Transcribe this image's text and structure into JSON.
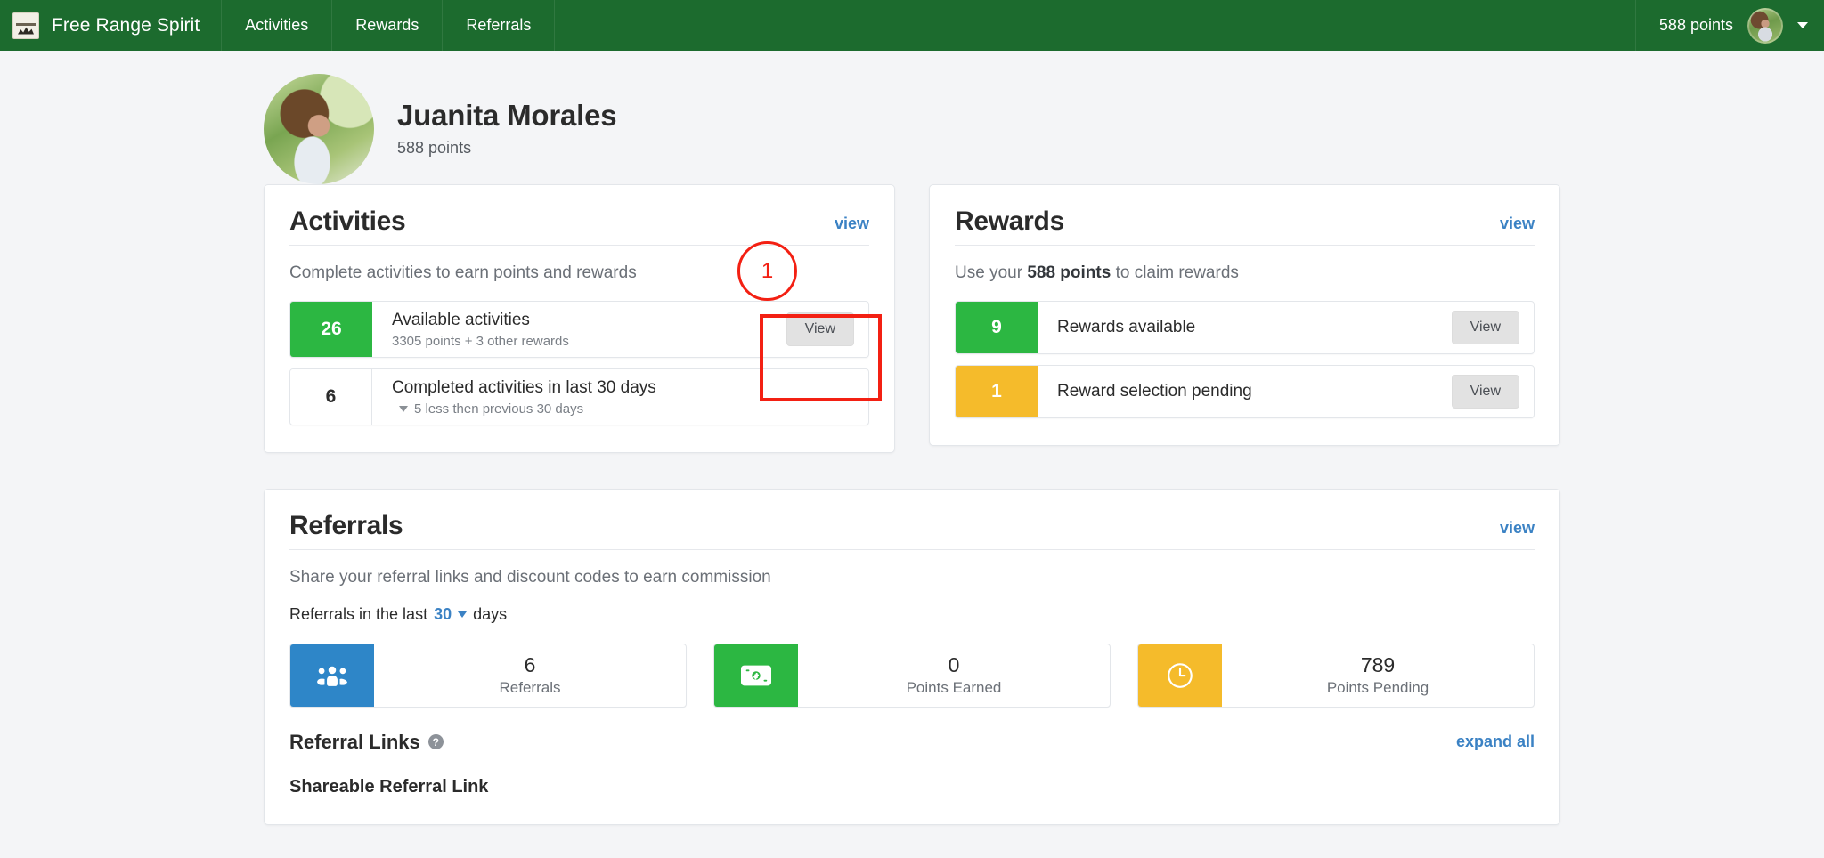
{
  "navbar": {
    "brand": "Free Range Spirit",
    "logo_icon": "mountain-crest-logo-icon",
    "links": [
      {
        "label": "Activities"
      },
      {
        "label": "Rewards"
      },
      {
        "label": "Referrals"
      }
    ],
    "points": "588 points",
    "avatar_icon": "user-avatar",
    "caret_icon": "chevron-down-icon"
  },
  "profile": {
    "avatar_icon": "profile-avatar",
    "name": "Juanita Morales",
    "points": "588 points"
  },
  "activities": {
    "title": "Activities",
    "view_link": "view",
    "subtitle": "Complete activities to earn points and rewards",
    "rows": [
      {
        "badge": "26",
        "badge_style": "green",
        "label": "Available activities",
        "meta": "3305 points + 3 other rewards",
        "button": "View"
      },
      {
        "badge": "6",
        "badge_style": "plain",
        "label": "Completed activities in last 30 days",
        "meta": "5 less then previous 30 days",
        "meta_icon": "triangle-down-icon"
      }
    ]
  },
  "rewards": {
    "title": "Rewards",
    "view_link": "view",
    "subtitle_pre": "Use your ",
    "subtitle_strong": "588 points",
    "subtitle_post": " to claim rewards",
    "rows": [
      {
        "badge": "9",
        "badge_style": "green",
        "label": "Rewards available",
        "button": "View"
      },
      {
        "badge": "1",
        "badge_style": "yellow",
        "label": "Reward selection pending",
        "button": "View"
      }
    ]
  },
  "referrals": {
    "title": "Referrals",
    "view_link": "view",
    "subtitle": "Share your referral links and discount codes to earn commission",
    "filter_pre": "Referrals in the last",
    "filter_days": "30",
    "filter_post": "days",
    "filter_caret_icon": "chevron-down-icon",
    "stats": [
      {
        "icon": "users-group-icon",
        "color": "blue",
        "value": "6",
        "caption": "Referrals"
      },
      {
        "icon": "banknote-icon",
        "color": "green",
        "value": "0",
        "caption": "Points Earned"
      },
      {
        "icon": "clock-icon",
        "color": "yellow",
        "value": "789",
        "caption": "Points Pending"
      }
    ],
    "links_section": {
      "title": "Referral Links",
      "help_icon": "question-mark-icon",
      "help_glyph": "?",
      "expand_all": "expand all",
      "shareable_title": "Shareable Referral Link"
    }
  },
  "annotations": [
    {
      "type": "circle",
      "label": "1",
      "color": "#f32013"
    },
    {
      "type": "rectangle",
      "target": "activities-view-button",
      "color": "#f32013"
    }
  ]
}
